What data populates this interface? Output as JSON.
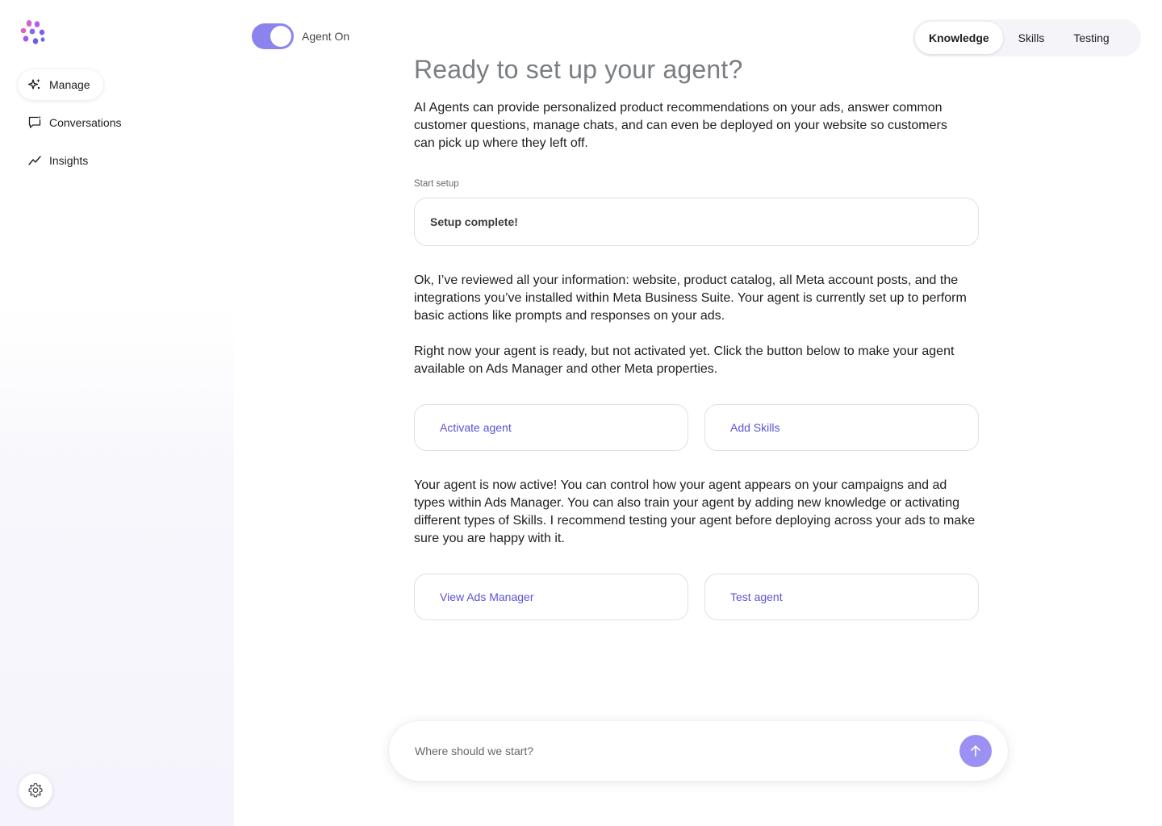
{
  "colors": {
    "accent": "#8b84ee",
    "link": "#5b53d6",
    "send_button": "#9a91f2"
  },
  "logo": {
    "icon": "flower-logo-icon"
  },
  "sidebar": {
    "items": [
      {
        "label": "Manage",
        "icon": "sparkle-icon",
        "active": true
      },
      {
        "label": "Conversations",
        "icon": "chat-bubble-icon",
        "active": false
      },
      {
        "label": "Insights",
        "icon": "trend-line-icon",
        "active": false
      }
    ],
    "settings_icon": "gear-icon"
  },
  "toggle": {
    "label": "Agent On",
    "on": true
  },
  "tabs": [
    {
      "label": "Knowledge",
      "active": true
    },
    {
      "label": "Skills",
      "active": false
    },
    {
      "label": "Testing",
      "active": false
    }
  ],
  "main": {
    "title": "Ready to set up your agent?",
    "intro": "AI Agents can provide personalized product recommendations on your ads, answer common customer questions, manage chats, and can even be deployed on your website so customers can pick up where they left off.",
    "setup_label": "Start setup",
    "setup_status": "Setup complete!",
    "review_text": "Ok, I’ve reviewed all your information: website, product catalog, all Meta account posts, and the integrations you’ve installed within Meta Business Suite. Your agent is currently set up to perform basic actions like prompts and responses on your ads.",
    "ready_text": "Right now your agent is ready, but not activated yet. Click the button below to make your agent available on Ads Manager and other Meta properties.",
    "activate_label": "Activate agent",
    "add_skills_label": "Add Skills",
    "active_text": "Your agent is now active! You can control how your agent appears on your campaigns and ad types within Ads Manager. You can also train your agent by adding new knowledge or activating different types of Skills. I recommend testing your agent before deploying across your ads to make sure you are happy with it.",
    "view_ads_label": "View Ads Manager",
    "test_agent_label": "Test agent"
  },
  "prompt": {
    "placeholder": "Where should we start?",
    "value": "",
    "send_icon": "arrow-up-icon"
  }
}
